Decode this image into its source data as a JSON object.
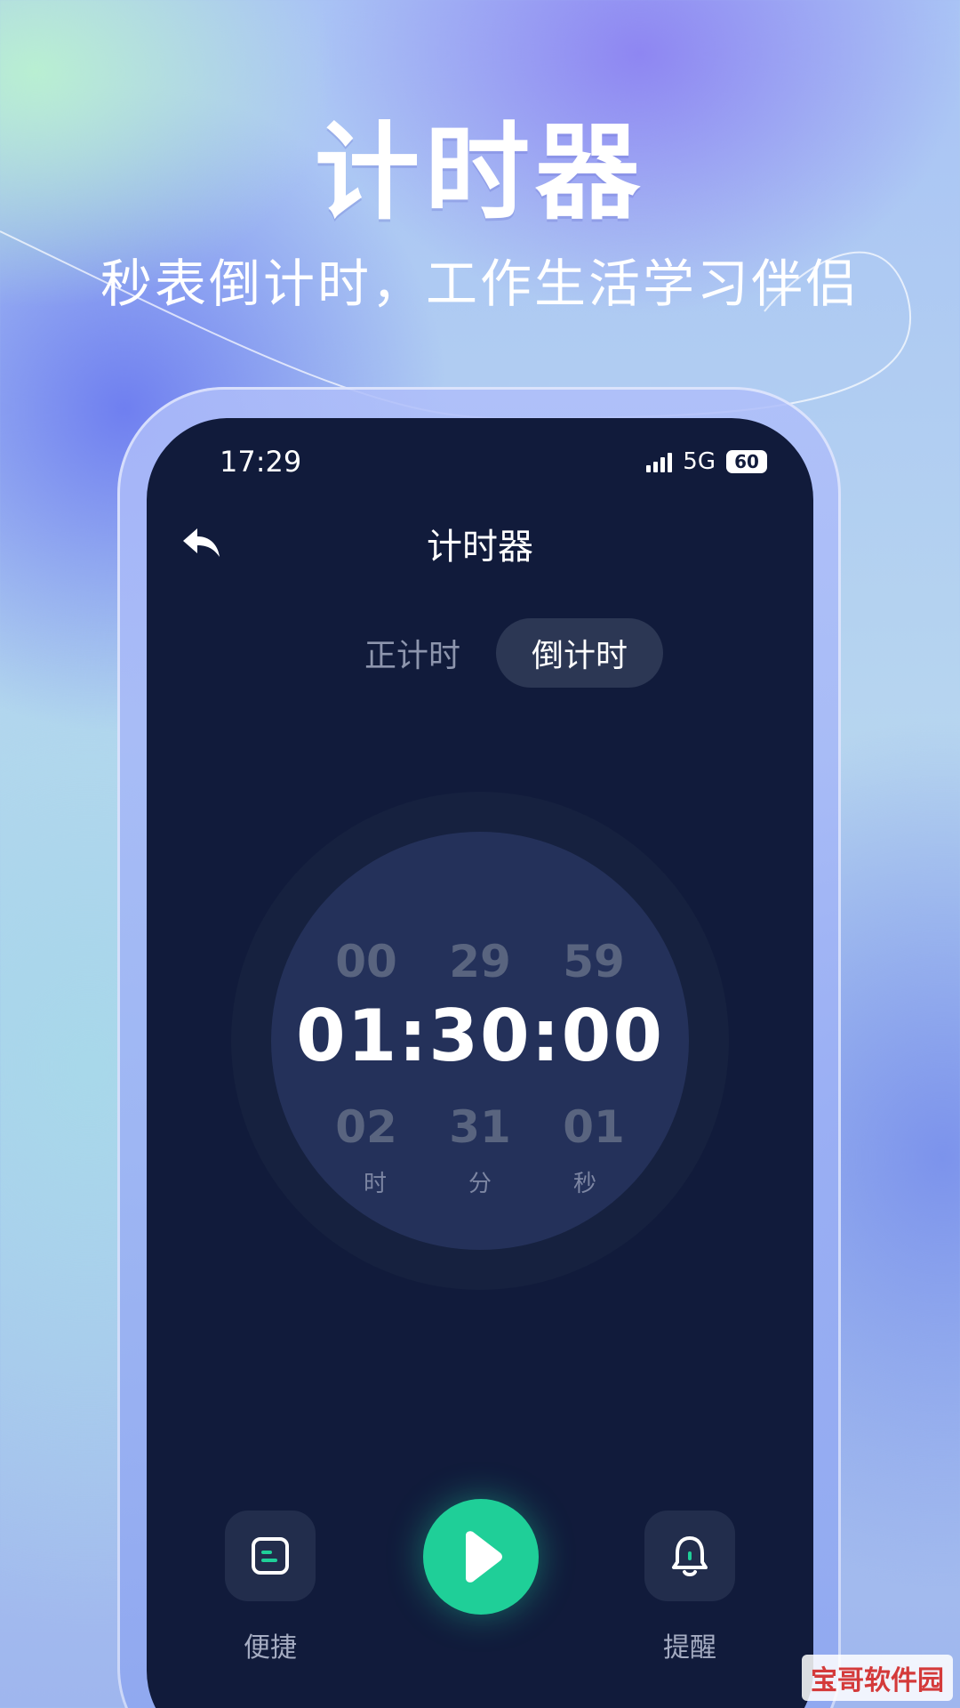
{
  "promo": {
    "title": "计时器",
    "subtitle": "秒表倒计时，工作生活学习伴侣"
  },
  "status_bar": {
    "time": "17:29",
    "network": "5G",
    "battery": "60"
  },
  "nav": {
    "title": "计时器"
  },
  "tabs": [
    {
      "label": "正计时",
      "active": false
    },
    {
      "label": "倒计时",
      "active": true
    }
  ],
  "picker": {
    "prev": [
      "00",
      "29",
      "59"
    ],
    "current": "01:30:00",
    "next": [
      "02",
      "31",
      "01"
    ],
    "units": [
      "时",
      "分",
      "秒"
    ]
  },
  "bottom_bar": {
    "shortcut_label": "便捷",
    "reminder_label": "提醒"
  },
  "colors": {
    "screen_bg": "#111b3b",
    "accent_green": "#1fcf98",
    "dial_inner": "#24315a"
  },
  "watermark": "宝哥软件园"
}
